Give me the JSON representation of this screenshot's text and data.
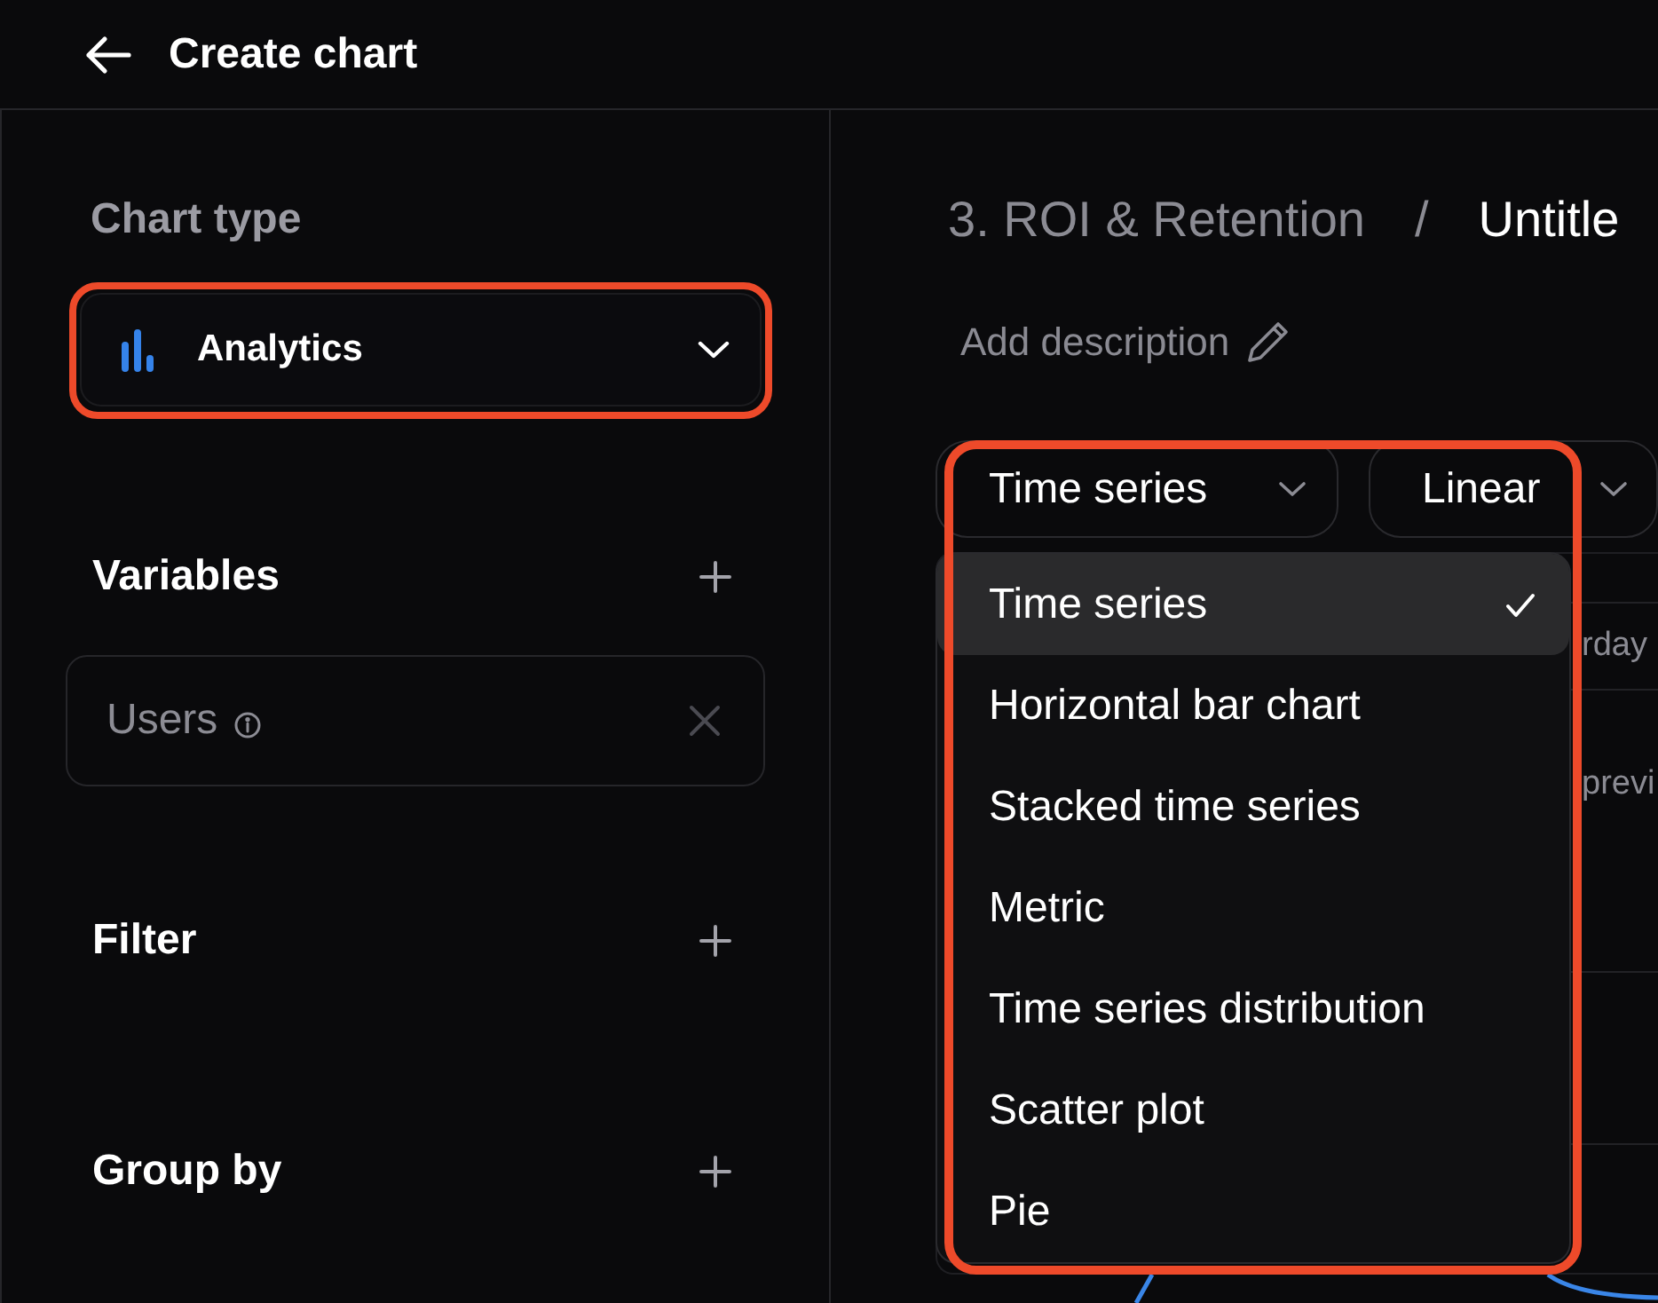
{
  "header": {
    "title": "Create chart"
  },
  "sidebar": {
    "chart_type": {
      "label": "Chart type",
      "value": "Analytics",
      "highlighted": true
    },
    "sections": [
      {
        "title": "Variables",
        "items": [
          {
            "name": "Users"
          }
        ]
      },
      {
        "title": "Filter"
      },
      {
        "title": "Group by"
      }
    ]
  },
  "main": {
    "breadcrumb": {
      "separator": "/",
      "items": [
        {
          "label": "3. ROI & Retention",
          "current": false
        },
        {
          "label": "Untitle",
          "current": true
        }
      ]
    },
    "description_button": "Add description",
    "toolbar": [
      {
        "kind": "chart_type",
        "value": "Time series"
      },
      {
        "kind": "scale",
        "value": "Linear"
      }
    ],
    "menu": {
      "open": true,
      "highlighted": true,
      "items": [
        {
          "label": "Time series",
          "selected": true
        },
        {
          "label": "Horizontal bar chart",
          "selected": false
        },
        {
          "label": "Stacked time series",
          "selected": false
        },
        {
          "label": "Metric",
          "selected": false
        },
        {
          "label": "Time series distribution",
          "selected": false
        },
        {
          "label": "Scatter plot",
          "selected": false
        },
        {
          "label": "Pie",
          "selected": false
        }
      ]
    },
    "panel_behind": {
      "rows": [
        {
          "text": "rday"
        },
        {
          "text": "previ"
        }
      ]
    }
  }
}
